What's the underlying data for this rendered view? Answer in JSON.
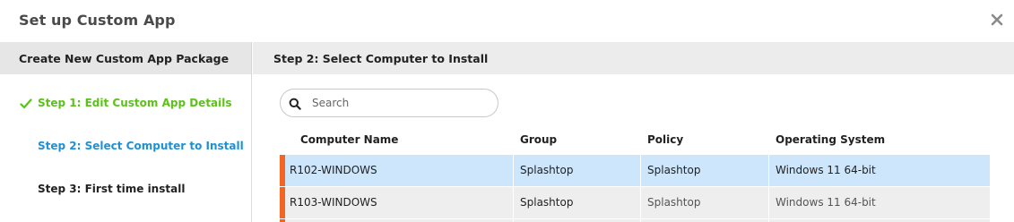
{
  "dialog": {
    "title": "Set up Custom App"
  },
  "left_panel": {
    "header": "Create New Custom App Package",
    "steps": [
      {
        "label": "Step 1: Edit Custom App Details",
        "state": "done"
      },
      {
        "label": "Step 2: Select Computer to Install",
        "state": "active"
      },
      {
        "label": "Step 3: First time install",
        "state": "pending"
      }
    ]
  },
  "right_panel": {
    "header": "Step 2: Select Computer to Install",
    "search": {
      "placeholder": "Search",
      "value": ""
    },
    "table": {
      "columns": [
        "Computer Name",
        "Group",
        "Policy",
        "Operating System"
      ],
      "rows": [
        {
          "name": "R102-WINDOWS",
          "group": "Splashtop",
          "policy": "Splashtop",
          "os": "Windows 11 64-bit",
          "selected": true
        },
        {
          "name": "R103-WINDOWS",
          "group": "Splashtop",
          "policy": "Splashtop",
          "os": "Windows 11 64-bit",
          "selected": false
        }
      ]
    }
  },
  "colors": {
    "step_done": "#5cc11a",
    "step_active": "#1e90d6",
    "row_marker": "#f26522",
    "row_selected": "#cde6fb"
  },
  "icons": {
    "close": "close-icon",
    "check": "check-icon",
    "search": "search-icon"
  }
}
